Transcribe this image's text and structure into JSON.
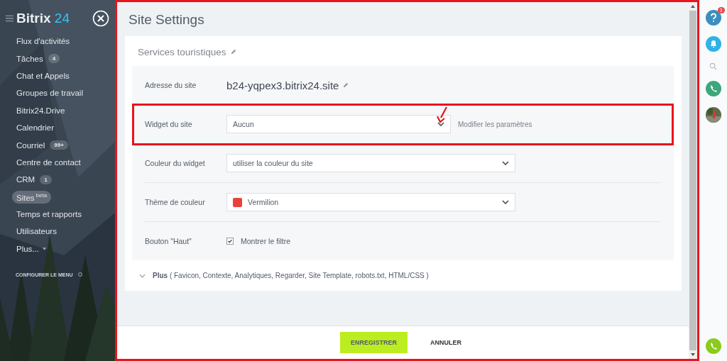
{
  "sidebar": {
    "logo": {
      "name": "Bitrix",
      "number": "24"
    },
    "items": [
      {
        "label": "Flux d'activités",
        "selected": false
      },
      {
        "label": "Tâches",
        "counter": "4",
        "selected": false
      },
      {
        "label": "Chat et Appels",
        "selected": false
      },
      {
        "label": "Groupes de travail",
        "selected": false
      },
      {
        "label": "Bitrix24.Drive",
        "selected": false
      },
      {
        "label": "Calendrier",
        "selected": false
      },
      {
        "label": "Courriel",
        "counter": "99+",
        "selected": false
      },
      {
        "label": "Centre de contact",
        "selected": false
      },
      {
        "label": "CRM",
        "counter": "1",
        "selected": false
      },
      {
        "label": "Sites",
        "sup": "beta",
        "selected": true
      },
      {
        "label": "Temps et rapports",
        "selected": false
      },
      {
        "label": "Utilisateurs",
        "selected": false
      },
      {
        "label": "Plus...",
        "caret": true,
        "selected": false
      }
    ],
    "configure": "CONFIGURER LE MENU"
  },
  "page": {
    "title": "Site Settings",
    "site_name": "Services touristiques",
    "rows": [
      {
        "kind": "address",
        "label": "Adresse du site",
        "value": "b24-yqpex3.bitrix24.site"
      },
      {
        "kind": "select",
        "label": "Widget du site",
        "value": "Aucun",
        "link": "Modifier les paramètres",
        "highlighted": true
      },
      {
        "kind": "select",
        "label": "Couleur du widget",
        "value": "utiliser la couleur du site"
      },
      {
        "kind": "select",
        "label": "Thème de couleur",
        "value": "Vermilion",
        "color": "#e8433a"
      },
      {
        "kind": "checkbox",
        "label": "Bouton \"Haut\"",
        "value": "Montrer le filtre",
        "checked": true
      }
    ],
    "more": "**Plus** ( Favicon,  Contexte,  Analytiques,  Regarder,  Site Template,  robots.txt,  HTML/CSS )",
    "buttons": [
      {
        "label": "ENREGISTRER",
        "kind": "primary"
      },
      {
        "label": "ANNULER",
        "kind": "link"
      }
    ]
  },
  "rightbar": {
    "help_badge": "3"
  }
}
